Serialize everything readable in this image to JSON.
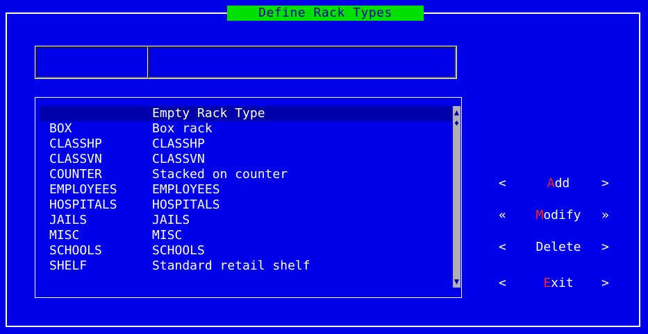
{
  "window": {
    "title": "Define Rack Types"
  },
  "entry": {
    "code_value": "",
    "description_value": ""
  },
  "list": {
    "rows": [
      {
        "code": "",
        "description": "Empty Rack Type",
        "selected": true
      },
      {
        "code": "BOX",
        "description": "Box rack"
      },
      {
        "code": "CLASSHP",
        "description": "CLASSHP"
      },
      {
        "code": "CLASSVN",
        "description": "CLASSVN"
      },
      {
        "code": "COUNTER",
        "description": "Stacked on counter"
      },
      {
        "code": "EMPLOYEES",
        "description": "EMPLOYEES"
      },
      {
        "code": "HOSPITALS",
        "description": "HOSPITALS"
      },
      {
        "code": "JAILS",
        "description": "JAILS"
      },
      {
        "code": "MISC",
        "description": "MISC"
      },
      {
        "code": "SCHOOLS",
        "description": "SCHOOLS"
      },
      {
        "code": "SHELF",
        "description": "Standard retail shelf"
      }
    ],
    "scroll_up_glyph": "▲",
    "scroll_thumb_glyph": "♦",
    "scroll_down_glyph": "▼"
  },
  "buttons": {
    "add": {
      "left": "<",
      "hotkey": "A",
      "rest": "dd",
      "right": ">"
    },
    "modify": {
      "left": "«",
      "hotkey": "M",
      "rest": "odify",
      "right": "»"
    },
    "delete": {
      "left": "<",
      "hotkey": "",
      "rest": "Delete",
      "right": ">"
    },
    "exit": {
      "left": "<",
      "hotkey": "E",
      "rest": "xit",
      "right": ">"
    }
  },
  "colors": {
    "background": "#0000e8",
    "title_bg": "#00e000",
    "selection": "#0000a8",
    "hotkey": "#ff2020",
    "scrollbar": "#b0b0b0"
  }
}
